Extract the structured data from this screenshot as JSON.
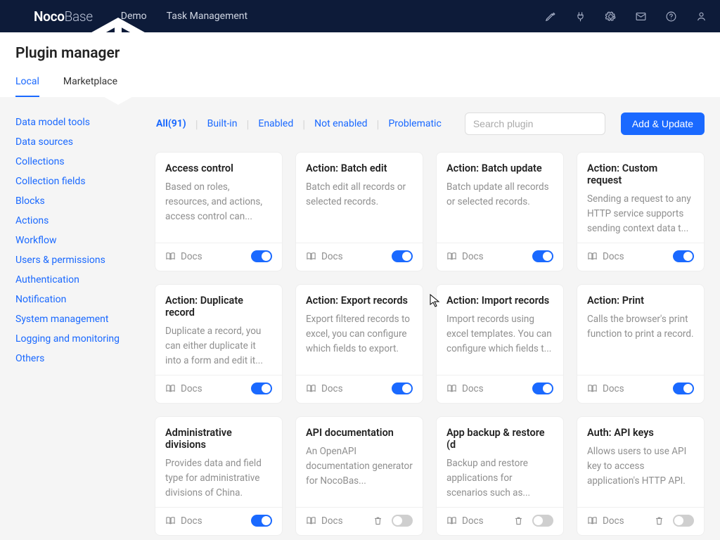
{
  "brand": {
    "name_bold": "Noco",
    "name_thin": "Base"
  },
  "topnav": {
    "demo": "Demo",
    "task": "Task Management"
  },
  "page": {
    "title": "Plugin manager"
  },
  "tabs": {
    "local": "Local",
    "marketplace": "Marketplace"
  },
  "sidebar": {
    "items": [
      "Data model tools",
      "Data sources",
      "Collections",
      "Collection fields",
      "Blocks",
      "Actions",
      "Workflow",
      "Users & permissions",
      "Authentication",
      "Notification",
      "System management",
      "Logging and monitoring",
      "Others"
    ]
  },
  "filters": {
    "all": "All(91)",
    "builtin": "Built-in",
    "enabled": "Enabled",
    "not_enabled": "Not enabled",
    "problematic": "Problematic"
  },
  "search": {
    "placeholder": "Search plugin"
  },
  "actions": {
    "add_update": "Add & Update",
    "docs": "Docs"
  },
  "plugins": [
    {
      "title": "Access control",
      "desc": "Based on roles, resources, and actions, access control can...",
      "enabled": true,
      "docs": true
    },
    {
      "title": "Action: Batch edit",
      "desc": "Batch edit all records or selected records.",
      "enabled": true,
      "docs": true
    },
    {
      "title": "Action: Batch update",
      "desc": "Batch update all records or selected records.",
      "enabled": true,
      "docs": true
    },
    {
      "title": "Action: Custom request",
      "desc": "Sending a request to any HTTP service supports sending context data t...",
      "enabled": true,
      "docs": true
    },
    {
      "title": "Action: Duplicate record",
      "desc": "Duplicate a record, you can either duplicate it into a form and edit it...",
      "enabled": true,
      "docs": true
    },
    {
      "title": "Action: Export records",
      "desc": "Export filtered records to excel, you can configure which fields to export.",
      "enabled": true,
      "docs": true
    },
    {
      "title": "Action: Import records",
      "desc": "Import records using excel templates. You can configure which fields t...",
      "enabled": true,
      "docs": true
    },
    {
      "title": "Action: Print",
      "desc": "Calls the browser's print function to print a record.",
      "enabled": true,
      "docs": true
    },
    {
      "title": "Administrative divisions",
      "desc": "Provides data and field type for administrative divisions of China.",
      "enabled": true,
      "docs": true
    },
    {
      "title": "API documentation",
      "desc": "An OpenAPI documentation generator for NocoBas...",
      "enabled": false,
      "docs": true,
      "deletable": true
    },
    {
      "title": "App backup & restore (d",
      "desc": "Backup and restore applications for scenarios such as...",
      "enabled": false,
      "docs": true,
      "deletable": true
    },
    {
      "title": "Auth: API keys",
      "desc": "Allows users to use API key to access application's HTTP API.",
      "enabled": false,
      "docs": true,
      "deletable": true
    }
  ]
}
